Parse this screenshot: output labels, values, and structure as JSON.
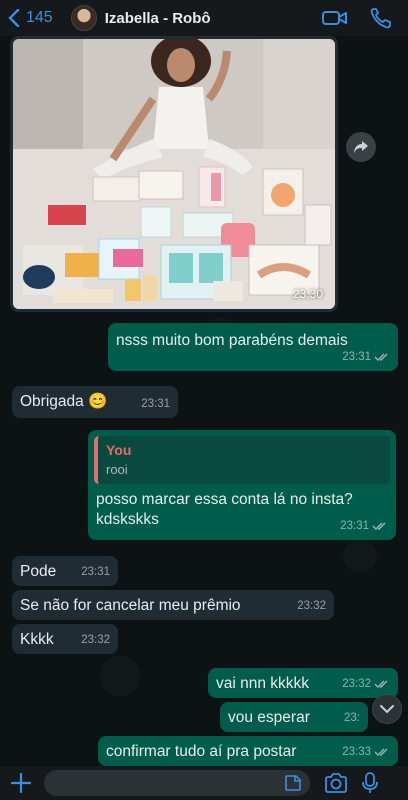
{
  "header": {
    "back_count": "145",
    "contact_name": "Izabella - Robô",
    "icons": [
      "chevron-left-icon",
      "video-call-icon",
      "phone-icon"
    ]
  },
  "messages": {
    "image": {
      "time": "23:30"
    },
    "m1": {
      "text": "nsss muito bom parabéns demais",
      "time": "23:31"
    },
    "m2": {
      "text": "Obrigada 😊",
      "time": "23:31"
    },
    "m3": {
      "quote_author": "You",
      "quote_text": "rooi",
      "text_line1": "posso marcar essa conta lá no insta?",
      "text_line2": "kdskskks",
      "time": "23:31"
    },
    "m4": {
      "text": "Pode",
      "time": "23:31"
    },
    "m5": {
      "text": "Se não for cancelar meu prêmio",
      "time": "23:32"
    },
    "m6": {
      "text": "Kkkk",
      "time": "23:32"
    },
    "m7": {
      "text": "vai nnn kkkkk",
      "time": "23:32"
    },
    "m8": {
      "text": "vou esperar",
      "time": "23:"
    },
    "m9": {
      "text": "confirmar tudo aí pra postar",
      "time": "23:33"
    }
  },
  "colors": {
    "outgoing": "#005c4b",
    "incoming": "#1f2c33",
    "accent": "#3b8fe0",
    "quote_author": "#e26d6d"
  }
}
